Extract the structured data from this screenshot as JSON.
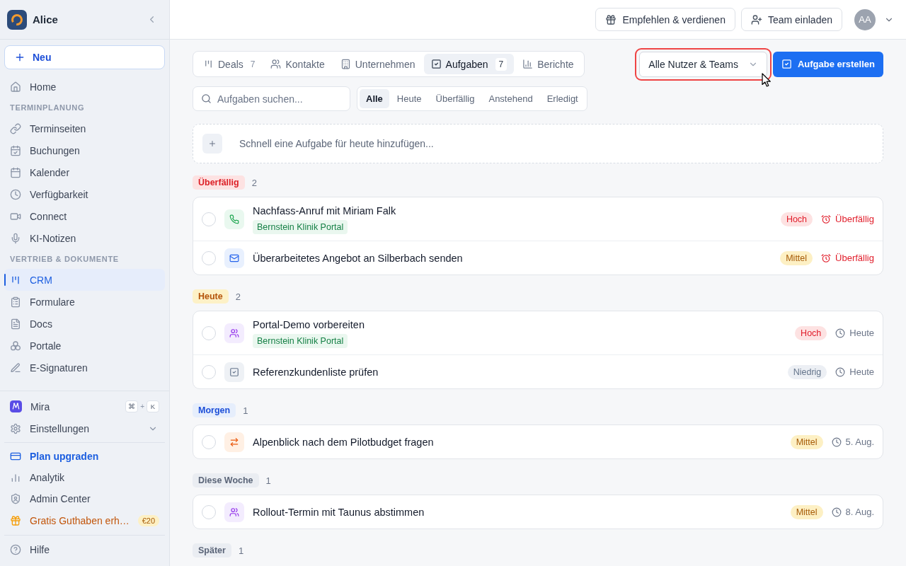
{
  "sidebar": {
    "workspace": "Alice",
    "new_button": "Neu",
    "home": {
      "label": "Home",
      "selected": false
    },
    "sections": [
      {
        "heading": "TERMINPLANUNG",
        "items": [
          {
            "label": "Terminseiten",
            "selected": false
          },
          {
            "label": "Buchungen",
            "selected": false
          },
          {
            "label": "Kalender",
            "selected": false
          },
          {
            "label": "Verfügbarkeit",
            "selected": false
          },
          {
            "label": "Connect",
            "selected": false
          },
          {
            "label": "KI-Notizen",
            "selected": false
          }
        ]
      },
      {
        "heading": "VERTRIEB & DOKUMENTE",
        "items": [
          {
            "label": "CRM",
            "selected": true
          },
          {
            "label": "Formulare",
            "selected": false
          },
          {
            "label": "Docs",
            "selected": false
          },
          {
            "label": "Portale",
            "selected": false
          },
          {
            "label": "E-Signaturen",
            "selected": false
          }
        ]
      }
    ],
    "assistant": {
      "label": "Mira",
      "shortcut": {
        "keys": [
          "⌘",
          "K"
        ],
        "joiner": "+"
      }
    },
    "settings": {
      "label": "Einstellungen",
      "expanded": false
    },
    "links": [
      {
        "label": "Plan upgraden",
        "kind": "upgrade"
      },
      {
        "label": "Analytik",
        "kind": "plain"
      },
      {
        "label": "Admin Center",
        "kind": "plain"
      },
      {
        "label": "Gratis Guthaben erh…",
        "kind": "promo",
        "badge": "€20"
      }
    ],
    "help": "Hilfe"
  },
  "topbar": {
    "buttons": [
      "Empfehlen & verdienen",
      "Team einladen"
    ],
    "avatar": "AA"
  },
  "tabs": [
    {
      "label": "Deals",
      "count": "7",
      "selected": false
    },
    {
      "label": "Kontakte",
      "selected": false
    },
    {
      "label": "Unternehmen",
      "selected": false
    },
    {
      "label": "Aufgaben",
      "count": "7",
      "selected": true
    },
    {
      "label": "Berichte",
      "selected": false
    }
  ],
  "owner_filter": {
    "value": "Alle Nutzer & Teams",
    "highlighted": true
  },
  "create_button": "Aufgabe erstellen",
  "search": {
    "placeholder": "Aufgaben suchen..."
  },
  "filters": [
    {
      "label": "Alle",
      "selected": true
    },
    {
      "label": "Heute",
      "selected": false
    },
    {
      "label": "Überfällig",
      "selected": false
    },
    {
      "label": "Anstehend",
      "selected": false
    },
    {
      "label": "Erledigt",
      "selected": false
    }
  ],
  "quick_add": {
    "placeholder": "Schnell eine Aufgabe für heute hinzufügen..."
  },
  "groups": [
    {
      "label": "Überfällig",
      "kind": "overdue",
      "count": "2",
      "tasks": [
        {
          "title": "Nachfass-Anruf mit Miriam Falk",
          "kind": "call",
          "checked": false,
          "tag": "Bernstein Klinik Portal",
          "priority": {
            "label": "Hoch",
            "kind": "high"
          },
          "due": {
            "label": "Überfällig",
            "overdue": true
          }
        },
        {
          "title": "Überarbeitetes Angebot an Silberbach senden",
          "kind": "email",
          "checked": false,
          "priority": {
            "label": "Mittel",
            "kind": "medium"
          },
          "due": {
            "label": "Überfällig",
            "overdue": true
          }
        }
      ]
    },
    {
      "label": "Heute",
      "kind": "today",
      "count": "2",
      "tasks": [
        {
          "title": "Portal-Demo vorbereiten",
          "kind": "meeting",
          "checked": false,
          "tag": "Bernstein Klinik Portal",
          "priority": {
            "label": "Hoch",
            "kind": "high"
          },
          "due": {
            "label": "Heute",
            "overdue": false
          }
        },
        {
          "title": "Referenzkundenliste prüfen",
          "kind": "todo",
          "checked": false,
          "priority": {
            "label": "Niedrig",
            "kind": "low"
          },
          "due": {
            "label": "Heute",
            "overdue": false
          }
        }
      ]
    },
    {
      "label": "Morgen",
      "kind": "tomorrow",
      "count": "1",
      "tasks": [
        {
          "title": "Alpenblick nach dem Pilotbudget fragen",
          "kind": "followup",
          "checked": false,
          "priority": {
            "label": "Mittel",
            "kind": "medium"
          },
          "due": {
            "label": "5. Aug.",
            "overdue": false
          }
        }
      ]
    },
    {
      "label": "Diese Woche",
      "kind": "week",
      "count": "1",
      "tasks": [
        {
          "title": "Rollout-Termin mit Taunus abstimmen",
          "kind": "meeting",
          "checked": false,
          "priority": {
            "label": "Mittel",
            "kind": "medium"
          },
          "due": {
            "label": "8. Aug.",
            "overdue": false
          }
        }
      ]
    },
    {
      "label": "Später",
      "kind": "later",
      "count": "1"
    }
  ]
}
